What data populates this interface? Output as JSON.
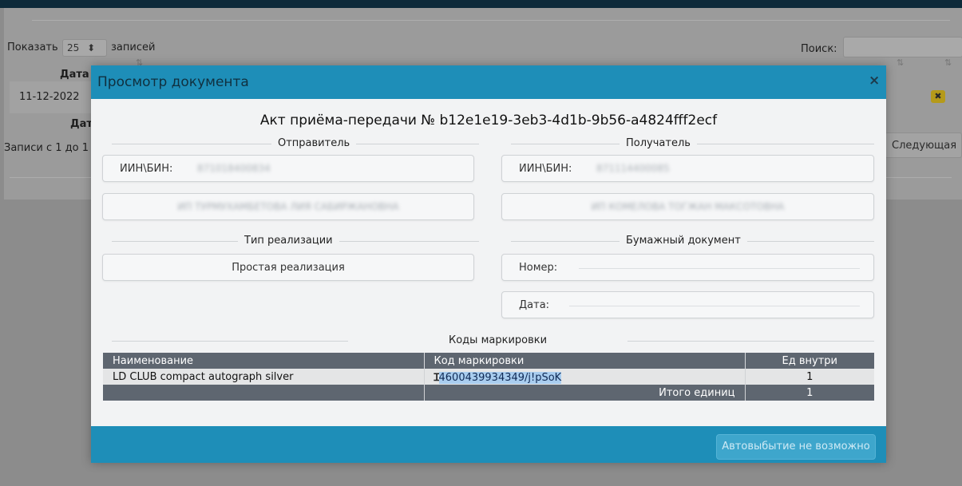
{
  "background": {
    "show_prefix": "Показать",
    "page_size": "25",
    "show_suffix": "записей",
    "search_label": "Поиск:",
    "col_date": "Дата",
    "row_date": "11-12-2022",
    "col_date_footer": "Дат",
    "records_info": "Записи с 1 до 1",
    "next_button": "Следующая",
    "delete_icon": "✖"
  },
  "modal": {
    "title": "Просмотр документа",
    "close": "×",
    "act_title": "Акт приёма-передачи № b12e1e19-3eb3-4d1b-9b56-a4824fff2ecf",
    "sender": {
      "section": "Отправитель",
      "iin_label": "ИИН\\БИН:",
      "iin_value": "871018400834",
      "name": "ИП ТУРМУХАМБЕТОВА ЛИЯ САБИРЖАНОВНА"
    },
    "receiver": {
      "section": "Получатель",
      "iin_label": "ИИН\\БИН:",
      "iin_value": "871114400085",
      "name": "ИП КОМЕЛОВА ТОГЖАН МАКСОТОВНА"
    },
    "realization": {
      "section": "Тип реализации",
      "value": "Простая реализация"
    },
    "paper": {
      "section": "Бумажный документ",
      "number_label": "Номер:",
      "date_label": "Дата:"
    },
    "codes": {
      "section": "Коды маркировки",
      "headers": [
        "Наименование",
        "Код маркировки",
        "Ед внутри"
      ],
      "rows": [
        {
          "name": "LD CLUB compact autograph silver",
          "code_prefix": "0",
          "code_selected": "4600439934349/j!pSoK",
          "qty": "1"
        }
      ],
      "total_label": "Итого единиц",
      "total_value": "1"
    },
    "auto_button": "Автовыбытие не возможно"
  },
  "colors": {
    "header_blue": "#1e8eb8",
    "table_header": "#5e6670"
  }
}
